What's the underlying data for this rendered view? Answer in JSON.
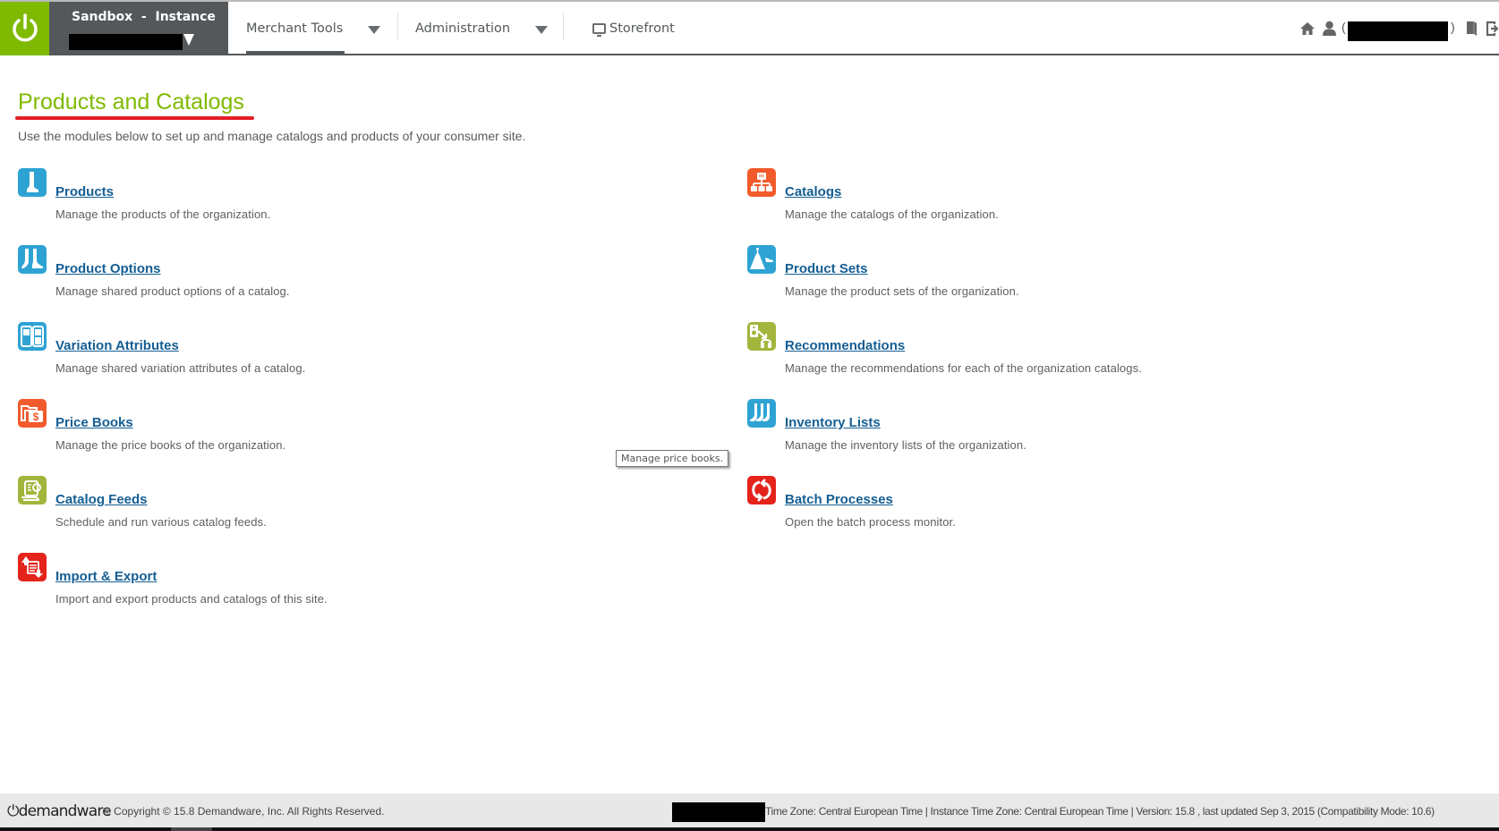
{
  "header": {
    "instance_title": "Sandbox  -  Instance",
    "nav": [
      {
        "label": "Merchant Tools",
        "has_dropdown": true,
        "active": true
      },
      {
        "label": "Administration",
        "has_dropdown": true,
        "active": false
      },
      {
        "label": "Storefront",
        "icon": "monitor-icon",
        "has_dropdown": false
      }
    ],
    "right_icons": [
      "home-icon",
      "user-icon",
      "help-book-icon",
      "logout-icon"
    ],
    "user_paren_open": "(",
    "user_paren_close": ")"
  },
  "page": {
    "title": "Products and Catalogs",
    "description": "Use the modules below to set up and manage catalogs and products of your consumer site."
  },
  "modules": {
    "left": [
      {
        "label": "Products",
        "description": "Manage the products of the organization.",
        "icon": "boot-icon",
        "color": "#2ea3d3"
      },
      {
        "label": "Product Options",
        "description": "Manage shared product options of a catalog.",
        "icon": "boots-pair-icon",
        "color": "#2ea3d3"
      },
      {
        "label": "Variation Attributes",
        "description": "Manage shared variation attributes of a catalog.",
        "icon": "variation-grid-icon",
        "color": "#2ea3d3"
      },
      {
        "label": "Price Books",
        "description": "Manage the price books of the organization.",
        "icon": "price-folder-icon",
        "color": "#f15a2b"
      },
      {
        "label": "Catalog Feeds",
        "description": "Schedule and run various catalog feeds.",
        "icon": "feed-icon",
        "color": "#a3b53c"
      },
      {
        "label": "Import & Export",
        "description": "Import and export products and catalogs of this site.",
        "icon": "import-export-icon",
        "color": "#e4231b"
      }
    ],
    "right": [
      {
        "label": "Catalogs",
        "description": "Manage the catalogs of the organization.",
        "icon": "sitemap-icon",
        "color": "#f15a2b"
      },
      {
        "label": "Product Sets",
        "description": "Manage the product sets of the organization.",
        "icon": "dress-shoe-icon",
        "color": "#2ea3d3"
      },
      {
        "label": "Recommendations",
        "description": "Manage the recommendations for each of the organization catalogs.",
        "icon": "recommendation-icon",
        "color": "#a3b53c"
      },
      {
        "label": "Inventory Lists",
        "description": "Manage the inventory lists of the organization.",
        "icon": "inventory-boots-icon",
        "color": "#2ea3d3"
      },
      {
        "label": "Batch Processes",
        "description": "Open the batch process monitor.",
        "icon": "refresh-icon",
        "color": "#e4231b"
      }
    ]
  },
  "tooltip": "Manage price books.",
  "footer": {
    "logo": "demandware",
    "copyright": "© Copyright © 15.8 Demandware, Inc. All Rights Reserved.",
    "info": "Time Zone: Central European Time | Instance Time Zone: Central European Time | Version: 15.8 , last updated Sep 3, 2015 (Compatibility Mode: 10.6)"
  },
  "colors": {
    "brand_green": "#7fba00",
    "header_dark": "#54585a",
    "link_blue": "#155e93",
    "title_underline_red": "#e31e24"
  }
}
